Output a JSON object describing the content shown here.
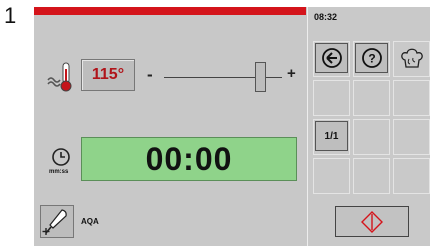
{
  "step_number": "1",
  "header": {
    "accent_color": "#d4141b"
  },
  "temperature": {
    "icon": "thermometer-icon",
    "value": "115°",
    "value_color": "#b0141a",
    "minus_label": "-",
    "plus_label": "+",
    "slider_position": 0.82
  },
  "timer": {
    "icon": "clock-icon",
    "unit_label": "mm:ss",
    "value": "00:00",
    "display_color": "#8fd38a"
  },
  "probe": {
    "icon": "core-probe-plus-icon",
    "label": "AQA"
  },
  "sidebar": {
    "clock": "08:32",
    "buttons": [
      {
        "name": "back-button",
        "icon": "back-arrow-icon"
      },
      {
        "name": "help-button",
        "icon": "question-icon"
      },
      {
        "name": "chef-button",
        "icon": "chef-hat-icon"
      }
    ],
    "ratio_label": "1/1",
    "start_icon": "start-diamond-icon"
  }
}
